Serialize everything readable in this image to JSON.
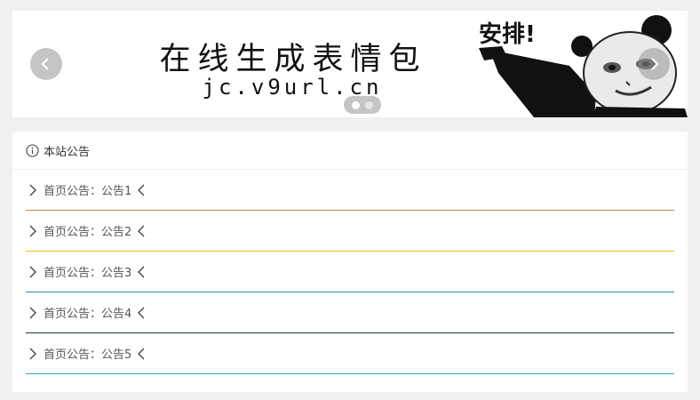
{
  "banner": {
    "title": "在线生成表情包",
    "url": "jc.v9url.cn",
    "meme_caption": "安排!",
    "slides": 2,
    "active_slide": 0
  },
  "icons": {
    "prev": "chevron-left-icon",
    "next": "chevron-right-icon",
    "info": "info-circle-icon"
  },
  "panel": {
    "title": "本站公告",
    "notices": [
      {
        "label": "首页公告：公告1",
        "color": "#b8865a"
      },
      {
        "label": "首页公告：公告2",
        "color": "#e0c020"
      },
      {
        "label": "首页公告：公告3",
        "color": "#2a8aa0"
      },
      {
        "label": "首页公告：公告4",
        "color": "#1a3a4a"
      },
      {
        "label": "首页公告：公告5",
        "color": "#30a8c8"
      }
    ]
  }
}
